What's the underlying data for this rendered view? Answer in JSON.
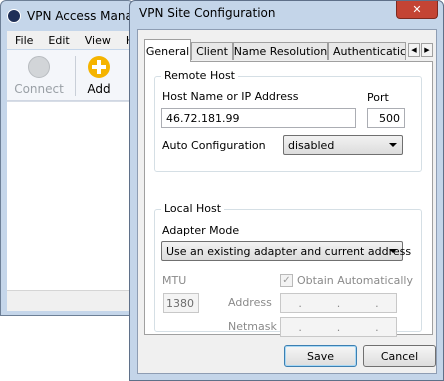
{
  "background_window": {
    "title": "VPN Access Manag",
    "menu": [
      "File",
      "Edit",
      "View",
      "H"
    ],
    "toolbar": {
      "connect_label": "Connect",
      "add_label": "Add"
    }
  },
  "dialog": {
    "title": "VPN Site Configuration",
    "close_symbol": "✕",
    "tabs": [
      "General",
      "Client",
      "Name Resolution",
      "Authenticatic"
    ],
    "remote_host": {
      "group_title": "Remote Host",
      "host_label": "Host Name or IP Address",
      "host_value": "46.72.181.99",
      "port_label": "Port",
      "port_value": "500",
      "auto_config_label": "Auto Configuration",
      "auto_config_value": "disabled"
    },
    "local_host": {
      "group_title": "Local Host",
      "adapter_mode_label": "Adapter Mode",
      "adapter_mode_value": "Use an existing adapter and current address",
      "mtu_label": "MTU",
      "mtu_value": "1380",
      "obtain_auto_label": "Obtain Automatically",
      "address_label": "Address",
      "netmask_label": "Netmask"
    },
    "buttons": {
      "save": "Save",
      "cancel": "Cancel"
    }
  }
}
